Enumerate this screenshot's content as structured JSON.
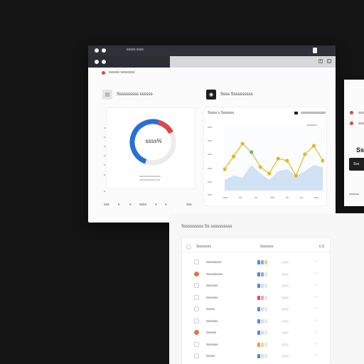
{
  "window": {
    "title": "sssss ssss",
    "toolbar_buttons": [
      "+",
      "▢"
    ]
  },
  "breadcrumb": "ssssss  ssssssss",
  "donut_card": {
    "title": "Ssssssssss ssssss",
    "center_label": "ssss%",
    "legend": [
      "sssssssssssssssss",
      "sssssssssssss sss"
    ],
    "y_labels": [
      "s",
      "s",
      "s",
      "s",
      "s",
      "s",
      "s"
    ],
    "bottom_labels": [
      "sss",
      "s",
      "s",
      "ssss",
      "s",
      "s",
      "sss"
    ]
  },
  "line_card": {
    "title": "Ssss Ssssssssss",
    "subtitle": "Sssss s Sssssss",
    "badge_label": "ssssssssssssss",
    "filter_label": "sssssss",
    "y_ticks": [
      "sss",
      "sss",
      "sss",
      "sss",
      "sss",
      "sss"
    ],
    "x_ticks": [
      "sss",
      "ss",
      "ss",
      "sss",
      "ss",
      "ss",
      "sss"
    ]
  },
  "chart_data": {
    "type": "line",
    "series": [
      {
        "values": [
          50,
          56,
          62,
          58,
          51,
          48,
          55,
          54,
          47,
          57,
          61,
          54
        ],
        "color": "#e6b820"
      },
      {
        "values": [
          45,
          47,
          46,
          52,
          48,
          45,
          49,
          50,
          47,
          49,
          52,
          51
        ],
        "color": "#b5d0ef",
        "fill": true
      }
    ],
    "highlight": {
      "index": 3,
      "color": "#5ac45a"
    },
    "ylim": [
      40,
      70
    ]
  },
  "side_panel": {
    "items": [
      "ssssssss",
      "ssssssss"
    ],
    "big_text": "Ss",
    "button_label": "Sss",
    "footer": "sssssss"
  },
  "table": {
    "title": "Ssssssssss Ss ssssssssss",
    "headers": [
      "Ssssssss",
      "Sssssss",
      "s S"
    ],
    "rows": [
      {
        "name": "Sssssssss",
        "icon": "none",
        "tags": [
          "#5a86d6",
          "#8aa8e0",
          "#f3d089"
        ]
      },
      {
        "name": "Ssssssssss",
        "icon": "orange",
        "tags": [
          "#5a86d6",
          "#8aa8e0",
          "#e8e8e8"
        ]
      },
      {
        "name": "Sssssss",
        "icon": "none",
        "tags": [
          "#5a86d6",
          "#d0ddf2",
          "#e8e8e8"
        ]
      },
      {
        "name": "Sssssss",
        "icon": "none",
        "tags": [
          "#e24c61",
          "#f1a3ae",
          "#e8e8e8"
        ]
      },
      {
        "name": "Sssss",
        "icon": "none",
        "tags": [
          "#5a86d6",
          "#d0ddf2",
          "#e8e8e8"
        ]
      },
      {
        "name": "Sssssss",
        "icon": "none",
        "tags": [
          "#5a86d6",
          "#d0ddf2",
          "#e8e8e8"
        ]
      },
      {
        "name": "Ssssss",
        "icon": "orange",
        "tags": [
          "#5a86d6",
          "#d0ddf2",
          "#e8e8e8"
        ]
      },
      {
        "name": "Sssssss",
        "icon": "none",
        "tags": [
          "#e3a33a",
          "#f3d089",
          "#e8e8e8"
        ]
      },
      {
        "name": "Sssss",
        "icon": "none",
        "tags": [
          "#5a86d6",
          "#d0ddf2",
          "#e8e8e8"
        ]
      }
    ]
  }
}
